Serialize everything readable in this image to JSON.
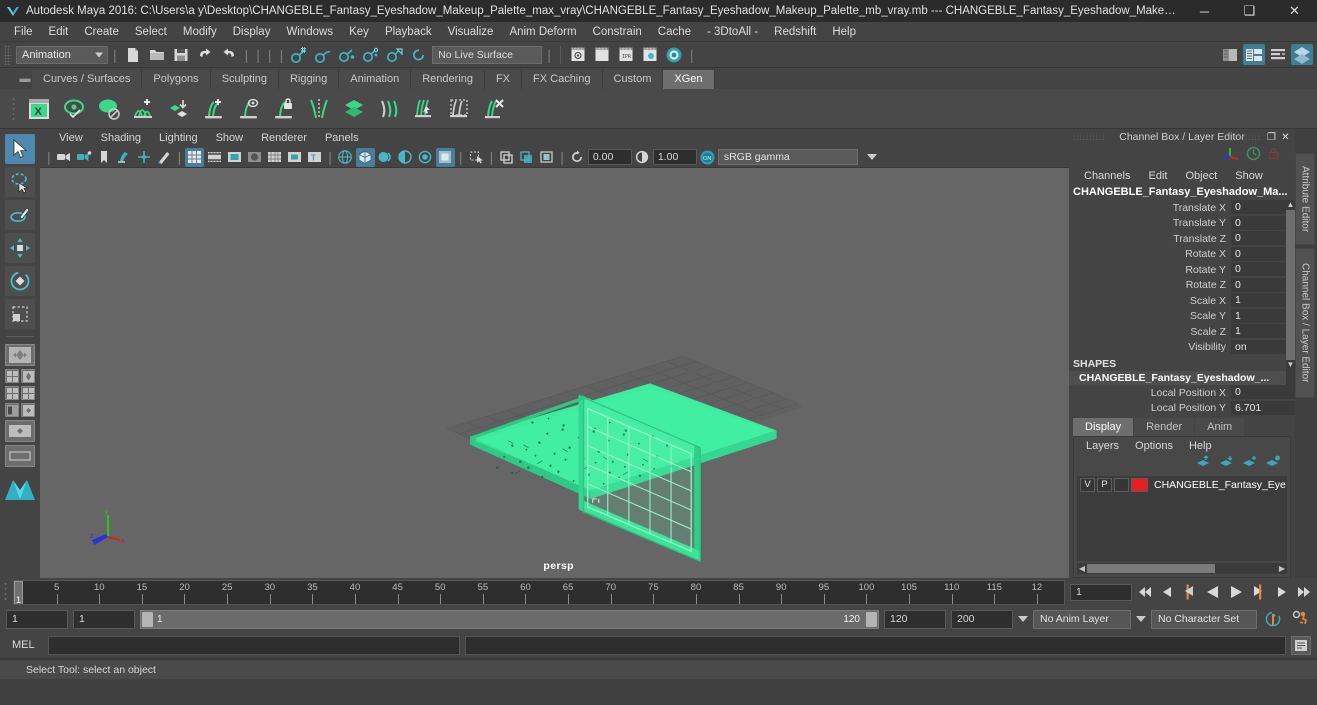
{
  "window": {
    "title": "Autodesk Maya 2016: C:\\Users\\a y\\Desktop\\CHANGEBLE_Fantasy_Eyeshadow_Makeup_Palette_max_vray\\CHANGEBLE_Fantasy_Eyeshadow_Makeup_Palette_mb_vray.mb  ---  CHANGEBLE_Fantasy_Eyeshadow_Makeup_Palett...",
    "minimize": "─",
    "maximize": "❑",
    "close": "✕",
    "logo_name": "maya-logo"
  },
  "menubar": {
    "items": [
      "File",
      "Edit",
      "Create",
      "Select",
      "Modify",
      "Display",
      "Windows",
      "Key",
      "Playback",
      "Visualize",
      "Anim Deform",
      "Constrain",
      "Cache",
      "- 3DtoAll -",
      "Redshift",
      "Help"
    ]
  },
  "statusline": {
    "menu_set": "Animation",
    "live_surface": "No Live Surface",
    "icons": [
      "new-scene-icon",
      "open-scene-icon",
      "save-scene-icon",
      "undo-icon",
      "redo-icon",
      "snap-to-grid-icon",
      "snap-to-curve-icon",
      "snap-to-point-icon",
      "snap-to-projected-center-icon",
      "snap-to-view-plane-icon",
      "make-live-icon",
      "render-current-frame-icon",
      "render-sequence-icon",
      "ipr-render-icon",
      "render-settings-icon",
      "hypershade-icon",
      "show-attribute-editor-icon",
      "show-tool-settings-icon",
      "show-channel-box-icon",
      "sidebar-toggle-icon"
    ]
  },
  "shelf": {
    "tabs": [
      "Curves / Surfaces",
      "Polygons",
      "Sculpting",
      "Rigging",
      "Animation",
      "Rendering",
      "FX",
      "FX Caching",
      "Custom",
      "XGen"
    ],
    "active_tab": "XGen",
    "icons": [
      "xgen-window-icon",
      "xgen-preview-icon",
      "xgen-preview-off-icon",
      "xgen-add-description-icon",
      "xgen-import-collection-icon",
      "xgen-add-guide-icon",
      "xgen-select-guide-icon",
      "xgen-lock-guide-icon",
      "xgen-mirror-guide-icon",
      "xgen-layers-icon",
      "xgen-sculpt-guide-icon",
      "xgen-groom-brush-icon",
      "xgen-region-mask-icon",
      "xgen-clear-icon"
    ]
  },
  "toolbox": {
    "items": [
      {
        "name": "select-tool",
        "active": true
      },
      {
        "name": "lasso-select-tool",
        "active": false
      },
      {
        "name": "paint-select-tool",
        "active": false
      },
      {
        "name": "move-tool",
        "active": false
      },
      {
        "name": "rotate-tool",
        "active": false
      },
      {
        "name": "scale-tool",
        "active": false
      },
      {
        "name": "last-tool-used",
        "active": false
      }
    ],
    "layouts": [
      "single-perspective-layout",
      "four-view-layout",
      "persp-outliner-layout",
      "persp-graph-editor-layout",
      "hypershade-persp-layout",
      "persp-only-layout"
    ]
  },
  "viewport": {
    "menus": [
      "View",
      "Shading",
      "Lighting",
      "Show",
      "Renderer",
      "Panels"
    ],
    "camera_label": "persp",
    "exposure": "0.00",
    "gamma": "1.00",
    "color_management": "sRGB gamma",
    "view_icons": [
      "select-camera-icon",
      "camera-attributes-icon",
      "bookmark-icon",
      "image-plane-icon",
      "two-d-pan-zoom-icon",
      "grease-pencil-icon",
      "grid-toggle-icon",
      "film-gate-icon",
      "resolution-gate-icon",
      "gate-mask-icon",
      "film-origin-icon",
      "field-chart-icon",
      "safe-action-icon",
      "wireframe-icon",
      "smooth-shade-all-icon",
      "shaded-wireframe-icon",
      "textured-icon",
      "use-default-lighting-icon",
      "shadows-icon",
      "screen-space-ao-icon",
      "motion-blur-icon",
      "multisample-icon",
      "depth-of-field-icon",
      "isolate-select-icon",
      "xray-icon",
      "xray-joints-icon",
      "xray-active-components-icon",
      "exposure-reset-icon",
      "gamma-reset-icon",
      "color-management-toggle-icon"
    ],
    "axis_labels": {
      "x": "x",
      "y": "y",
      "z": "z"
    },
    "model_name": "CHANGEBLE_Fantasy_Eyeshadow_Makeup_Palette",
    "selection_color": "#3dedа0"
  },
  "channel_box": {
    "panel_title": "Channel Box / Layer Editor",
    "undock_icon": "undock-icon",
    "close_icon": "close-icon",
    "menus": [
      "Channels",
      "Edit",
      "Object",
      "Show"
    ],
    "object_name": "CHANGEBLE_Fantasy_Eyeshadow_Ma...",
    "transform_attributes": [
      {
        "label": "Translate X",
        "value": "0"
      },
      {
        "label": "Translate Y",
        "value": "0"
      },
      {
        "label": "Translate Z",
        "value": "0"
      },
      {
        "label": "Rotate X",
        "value": "0"
      },
      {
        "label": "Rotate Y",
        "value": "0"
      },
      {
        "label": "Rotate Z",
        "value": "0"
      },
      {
        "label": "Scale X",
        "value": "1"
      },
      {
        "label": "Scale Y",
        "value": "1"
      },
      {
        "label": "Scale Z",
        "value": "1"
      },
      {
        "label": "Visibility",
        "value": "on"
      }
    ],
    "shapes_header": "SHAPES",
    "shape_name": "CHANGEBLE_Fantasy_Eyeshadow_...",
    "shape_attributes": [
      {
        "label": "Local Position X",
        "value": "0"
      },
      {
        "label": "Local Position Y",
        "value": "6.701"
      }
    ]
  },
  "layer_editor": {
    "tabs": [
      "Display",
      "Render",
      "Anim"
    ],
    "active_tab": "Display",
    "menus": [
      "Layers",
      "Options",
      "Help"
    ],
    "buttons": [
      "create-empty-layer-icon",
      "create-layer-from-selected-icon",
      "add-selected-to-layer-icon",
      "remove-selected-from-layer-icon"
    ],
    "layers": [
      {
        "visibility": "V",
        "playback": "P",
        "shading": "",
        "color": "#e81d22",
        "name": "CHANGEBLE_Fantasy_Eye"
      }
    ]
  },
  "right_tabs": [
    "Attribute Editor",
    "Channel Box / Layer Editor"
  ],
  "timeline": {
    "tick_labels": [
      "5",
      "10",
      "15",
      "20",
      "25",
      "30",
      "35",
      "40",
      "45",
      "50",
      "55",
      "60",
      "65",
      "70",
      "75",
      "80",
      "85",
      "90",
      "95",
      "100",
      "105",
      "110",
      "115",
      "12"
    ],
    "current_frame_marker": "1",
    "current_frame_field": "1",
    "playback_buttons": [
      "go-to-start-icon",
      "step-back-keyframe-icon",
      "step-back-frame-icon",
      "play-backwards-icon",
      "play-forwards-icon",
      "step-forward-frame-icon",
      "step-forward-keyframe-icon",
      "go-to-end-icon"
    ]
  },
  "range_slider": {
    "anim_start": "1",
    "range_start": "1",
    "range_bar_start": "1",
    "range_bar_end": "120",
    "range_end": "120",
    "anim_end": "200",
    "anim_layer": "No Anim Layer",
    "character_set": "No Character Set",
    "auto_key_icon": "auto-keyframe-icon",
    "anim_prefs_icon": "animation-preferences-icon"
  },
  "command_line": {
    "language": "MEL",
    "input_value": "",
    "output_value": "",
    "script_editor_icon": "script-editor-icon"
  },
  "status_bar": {
    "help_text": "Select Tool: select an object"
  },
  "colors": {
    "window_bg": "#444444",
    "titlebar_bg": "#2b2b2b",
    "viewport_bg": "#666666",
    "accent_blue": "#4e88ad",
    "selection_green": "#3ded9f",
    "teal_icon": "#3aa9b8",
    "layer_red": "#e81d22"
  }
}
